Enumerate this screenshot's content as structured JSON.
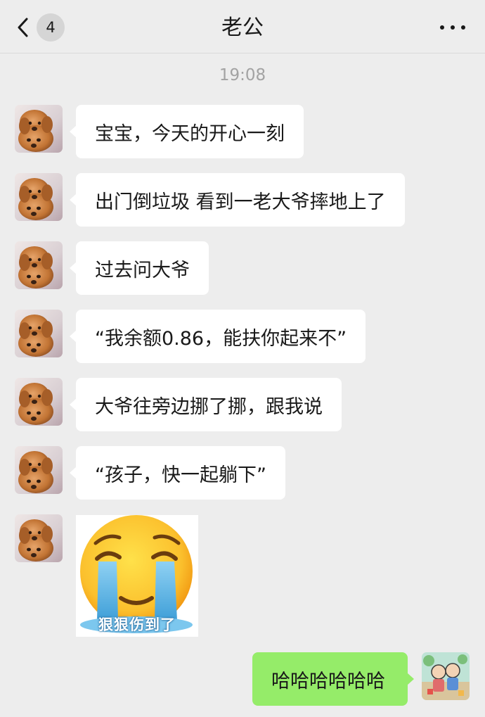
{
  "header": {
    "back_icon": "chevron-left-icon",
    "unread_count": "4",
    "title": "老公",
    "more_icon": "ellipsis-icon"
  },
  "timestamp": "19:08",
  "messages": [
    {
      "from": "them",
      "type": "text",
      "text": "宝宝，今天的开心一刻"
    },
    {
      "from": "them",
      "type": "text",
      "text": "出门倒垃圾 看到一老大爷摔地上了"
    },
    {
      "from": "them",
      "type": "text",
      "text": "过去问大爷"
    },
    {
      "from": "them",
      "type": "text",
      "text": "“我余额0.86，能扶你起来不”"
    },
    {
      "from": "them",
      "type": "text",
      "text": "大爷往旁边挪了挪，跟我说"
    },
    {
      "from": "them",
      "type": "text",
      "text": "“孩子，快一起躺下”"
    },
    {
      "from": "them",
      "type": "sticker",
      "icon": "crying-face-sticker",
      "caption": "狠狠伤到了"
    },
    {
      "from": "me",
      "type": "text",
      "text": "哈哈哈哈哈哈"
    }
  ],
  "colors": {
    "background": "#ededed",
    "bubble_incoming": "#ffffff",
    "bubble_outgoing": "#95ec69",
    "timestamp_text": "#a3a3a3"
  }
}
